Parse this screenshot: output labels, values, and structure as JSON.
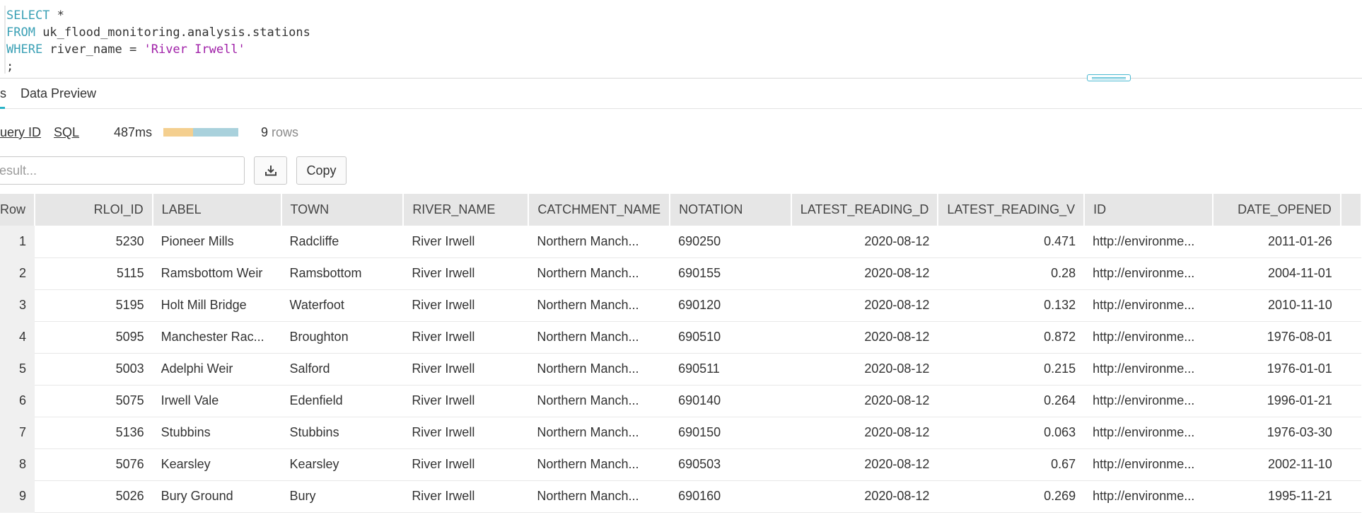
{
  "editor": {
    "line1_kw": "SELECT",
    "line1_rest": " *",
    "line2_kw": "FROM",
    "line2_rest": " uk_flood_monitoring.analysis.stations",
    "line3_kw": "WHERE",
    "line3_rest": " river_name = ",
    "line3_str": "'River Irwell'",
    "line4": ";"
  },
  "tabs": {
    "partial_label": "s",
    "preview_label": "Data Preview"
  },
  "meta": {
    "query_id_label": "uery ID",
    "sql_label": "SQL",
    "duration": "487ms",
    "row_count": "9",
    "row_unit": "rows",
    "timing_split": 0.4
  },
  "filter": {
    "placeholder": "esult..."
  },
  "buttons": {
    "download_icon": "download-icon",
    "copy_label": "Copy"
  },
  "table": {
    "columns": [
      "Row",
      "RLOI_ID",
      "LABEL",
      "TOWN",
      "RIVER_NAME",
      "CATCHMENT_NAME",
      "NOTATION",
      "LATEST_READING_D",
      "LATEST_READING_V",
      "ID",
      "DATE_OPENED"
    ],
    "rows": [
      [
        "1",
        "5230",
        "Pioneer Mills",
        "Radcliffe",
        "River Irwell",
        "Northern Manch...",
        "690250",
        "2020-08-12",
        "0.471",
        "http://environme...",
        "2011-01-26"
      ],
      [
        "2",
        "5115",
        "Ramsbottom Weir",
        "Ramsbottom",
        "River Irwell",
        "Northern Manch...",
        "690155",
        "2020-08-12",
        "0.28",
        "http://environme...",
        "2004-11-01"
      ],
      [
        "3",
        "5195",
        "Holt Mill Bridge",
        "Waterfoot",
        "River Irwell",
        "Northern Manch...",
        "690120",
        "2020-08-12",
        "0.132",
        "http://environme...",
        "2010-11-10"
      ],
      [
        "4",
        "5095",
        "Manchester Rac...",
        "Broughton",
        "River Irwell",
        "Northern Manch...",
        "690510",
        "2020-08-12",
        "0.872",
        "http://environme...",
        "1976-08-01"
      ],
      [
        "5",
        "5003",
        "Adelphi Weir",
        "Salford",
        "River Irwell",
        "Northern Manch...",
        "690511",
        "2020-08-12",
        "0.215",
        "http://environme...",
        "1976-01-01"
      ],
      [
        "6",
        "5075",
        "Irwell Vale",
        "Edenfield",
        "River Irwell",
        "Northern Manch...",
        "690140",
        "2020-08-12",
        "0.264",
        "http://environme...",
        "1996-01-21"
      ],
      [
        "7",
        "5136",
        "Stubbins",
        "Stubbins",
        "River Irwell",
        "Northern Manch...",
        "690150",
        "2020-08-12",
        "0.063",
        "http://environme...",
        "1976-03-30"
      ],
      [
        "8",
        "5076",
        "Kearsley",
        "Kearsley",
        "River Irwell",
        "Northern Manch...",
        "690503",
        "2020-08-12",
        "0.67",
        "http://environme...",
        "2002-11-10"
      ],
      [
        "9",
        "5026",
        "Bury Ground",
        "Bury",
        "River Irwell",
        "Northern Manch...",
        "690160",
        "2020-08-12",
        "0.269",
        "http://environme...",
        "1995-11-21"
      ]
    ]
  }
}
